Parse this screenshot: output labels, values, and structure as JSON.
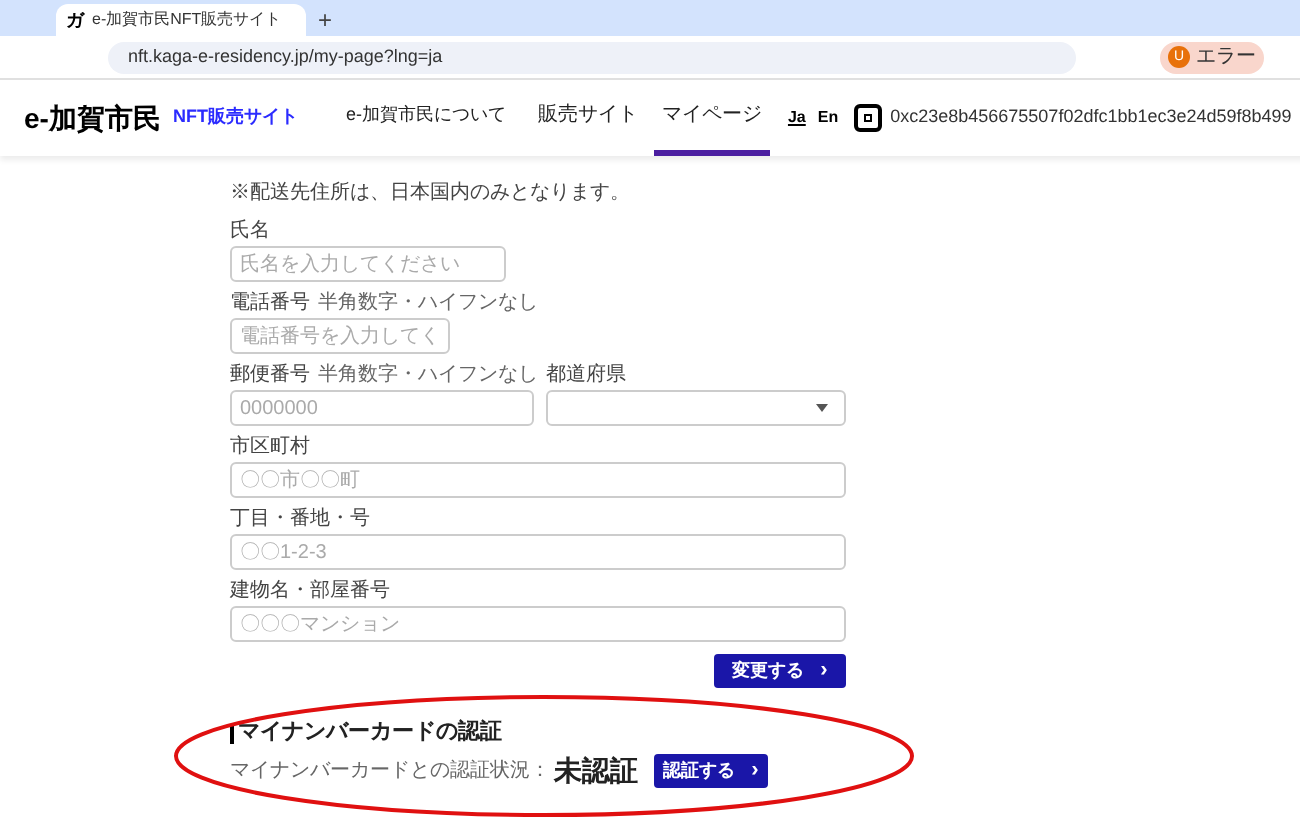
{
  "browser": {
    "tab_title": "e-加賀市民NFT販売サイト",
    "tab_icon": "ガ",
    "new_tab": "+",
    "url": "nft.kaga-e-residency.jp/my-page?lng=ja",
    "profile": "エラー",
    "profile_initial": "U"
  },
  "header": {
    "logo": "e-加賀市民",
    "subtitle": "NFT販売サイト",
    "nav": [
      {
        "label": "e-加賀市民について",
        "selected": false,
        "kind": "small"
      },
      {
        "label": "販売サイト",
        "selected": false,
        "kind": "large"
      },
      {
        "label": "マイページ",
        "selected": true,
        "kind": "large"
      }
    ],
    "languages": [
      {
        "label": "Ja",
        "selected": true
      },
      {
        "label": "En",
        "selected": false
      }
    ],
    "wallet_address": "0xc23e8b456675507f02dfc1bb1ec3e24d59f8b499"
  },
  "form": {
    "note": "※配送先住所は、日本国内のみとなります。",
    "fields": [
      {
        "label": "氏名",
        "placeholder": "氏名を入力してください",
        "kind": "text"
      },
      {
        "label": "電話番号",
        "hint": "半角数字・ハイフンなし",
        "placeholder": "電話番号を入力してく",
        "kind": "text"
      },
      {
        "label": "郵便番号",
        "hint": "半角数字・ハイフンなし",
        "placeholder": "0000000",
        "kind": "text"
      },
      {
        "label": "都道府県",
        "kind": "select"
      },
      {
        "label": "市区町村",
        "placeholder": "〇〇市〇〇町",
        "kind": "text"
      },
      {
        "label": "丁目・番地・号",
        "placeholder": "〇〇1-2-3",
        "kind": "text"
      },
      {
        "label": "建物名・部屋番号",
        "placeholder": "〇〇〇マンション",
        "kind": "text"
      }
    ],
    "submit": "変更する",
    "submit_icon": "›"
  },
  "verification": {
    "title": "マイナンバーカードの認証",
    "status_label": "マイナンバーカードとの認証状況：",
    "status": "未認証",
    "button": "認証する",
    "button_icon": "›"
  }
}
